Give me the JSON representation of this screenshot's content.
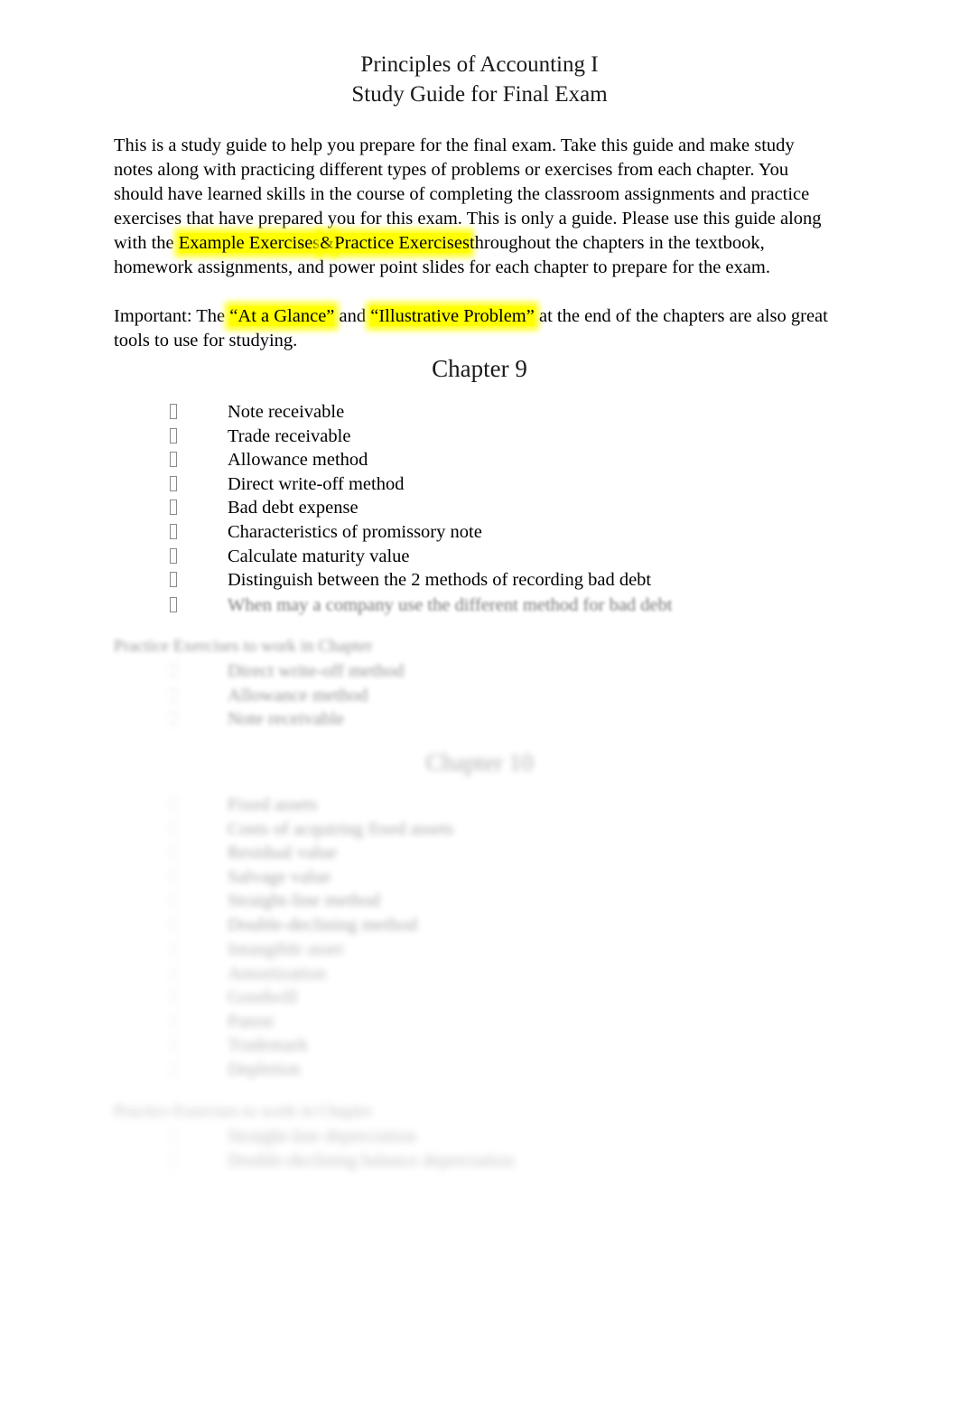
{
  "document": {
    "title_line1": "Principles of Accounting I",
    "title_line2": "Study Guide for Final Exam"
  },
  "intro": {
    "seg1": "This is a study guide to help you prepare for the final exam.  Take this guide and make study notes along with practicing different types of problems or exercises from each chapter.    You should have learned skills in the course of completing the classroom assignments and practice exercises that have prepared you for this exam.  This is only a guide. Please use this guide along with the ",
    "highlight1": "Example Exercises",
    "seg2": "&",
    "highlight2": "Practice Exercises",
    "seg3": "throughout the chapters in the textbook, homework assignments, and power point slides for each chapter to prepare for the exam."
  },
  "important": {
    "seg1": "Important:   The ",
    "highlight1": "“At a Glance”",
    "seg2": " and ",
    "highlight2": "“Illustrative Problem”",
    "seg3": " at the end of the chapters are also great tools to use for studying."
  },
  "chapter9": {
    "heading": "Chapter 9",
    "topics": [
      "Note receivable",
      "Trade receivable",
      "Allowance method",
      "Direct write-off method",
      "Bad debt expense",
      "Characteristics of promissory note",
      "Calculate maturity value",
      "Distinguish between the 2 methods of recording bad debt",
      "When may a company use the different method for bad debt"
    ],
    "practice_label": "Practice Exercises to work in Chapter",
    "practice_items": [
      "Direct write-off method",
      "Allowance method",
      "Note receivable"
    ]
  },
  "chapter10": {
    "heading": "Chapter 10",
    "topics": [
      "Fixed assets",
      "Costs of acquiring fixed assets",
      "Residual value",
      "Salvage value",
      "Straight-line method",
      "Double-declining method",
      "Intangible asset",
      "Amortization",
      "Goodwill",
      "Patent",
      "Trademark",
      "Depletion"
    ],
    "practice_label": "Practice Exercises to work in Chapter",
    "practice_items": [
      "Straight-line depreciation",
      "Double-declining balance depreciation"
    ]
  },
  "icons": {
    "bullet": "missing-glyph-box"
  },
  "colors": {
    "highlight": "#ffff00",
    "text": "#000000",
    "page": "#ffffff"
  }
}
